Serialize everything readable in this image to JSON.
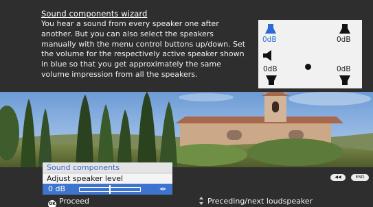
{
  "wizard": {
    "title": "Sound components wizard",
    "description": "You hear a sound from every speaker one after another. But you can also select the speakers manually with the menu control buttons up/down. Set the volume for the respectively active speaker shown in blue so that you get approximately the same volume impression from all the speakers."
  },
  "speakers": {
    "front_left": "0dB",
    "front_right": "0dB",
    "rear_left": "0dB",
    "rear_right": "0dB",
    "active_color": "#2a6bd6"
  },
  "menu": {
    "header": "Sound components",
    "item": "Adjust speaker level",
    "value": "0 dB",
    "slider_position": 0.5,
    "arrow_hint": "◂ ▸"
  },
  "footer": {
    "ok_icon_text": "OK",
    "proceed_label": "Proceed",
    "nav_label": "Preceding/next loudspeaker"
  },
  "pills": {
    "back_label": "◀◀",
    "end_label": "END"
  }
}
